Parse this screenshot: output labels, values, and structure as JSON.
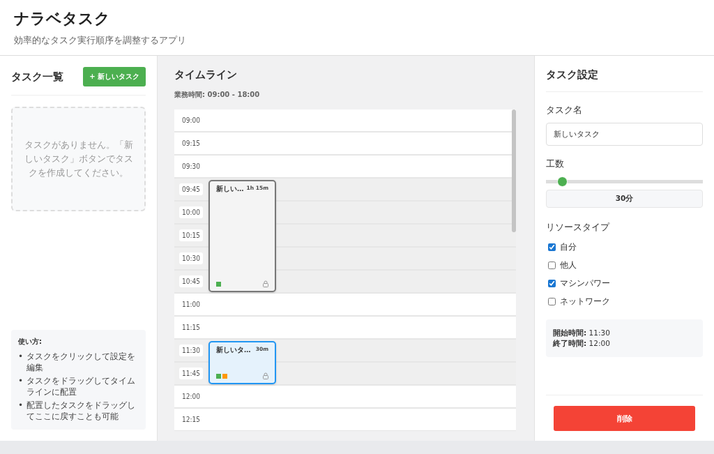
{
  "header": {
    "title": "ナラベタスク",
    "subtitle": "効率的なタスク実行順序を調整するアプリ"
  },
  "task_list": {
    "title": "タスク一覧",
    "new_button": "+ 新しいタスク",
    "empty_message": "タスクがありません。「新しいタスク」ボタンでタスクを作成してください。",
    "help": {
      "title": "使い方:",
      "items": [
        {
          "bullet": "•",
          "text": "タスクをクリックして設定を編集"
        },
        {
          "bullet": "•",
          "text": "タスクをドラッグしてタイムラインに配置"
        },
        {
          "bullet": "•",
          "text": "配置したタスクをドラッグしてここに戻すことも可能"
        }
      ]
    }
  },
  "timeline": {
    "title": "タイムライン",
    "hours": "業務時間: 09:00 - 18:00",
    "slots": [
      {
        "time": "09:00",
        "occupied": false
      },
      {
        "time": "09:15",
        "occupied": false
      },
      {
        "time": "09:30",
        "occupied": false
      },
      {
        "time": "09:45",
        "occupied": true,
        "task": {
          "title": "新しい…",
          "duration": "1h 15m",
          "selected": false,
          "resources": [
            {
              "color": "#4caf50"
            }
          ]
        }
      },
      {
        "time": "10:00",
        "occupied": true
      },
      {
        "time": "10:15",
        "occupied": true
      },
      {
        "time": "10:30",
        "occupied": true
      },
      {
        "time": "10:45",
        "occupied": true
      },
      {
        "time": "11:00",
        "occupied": false
      },
      {
        "time": "11:15",
        "occupied": false
      },
      {
        "time": "11:30",
        "occupied": true,
        "task": {
          "title": "新しいタ…",
          "duration": "30m",
          "selected": true,
          "resources": [
            {
              "color": "#4caf50"
            },
            {
              "color": "#ff9800"
            }
          ]
        }
      },
      {
        "time": "11:45",
        "occupied": true
      },
      {
        "time": "12:00",
        "occupied": false
      },
      {
        "time": "12:15",
        "occupied": false
      }
    ]
  },
  "settings": {
    "title": "タスク設定",
    "name_label": "タスク名",
    "name_value": "新しいタスク",
    "effort_label": "工数",
    "effort": {
      "level": 0.1,
      "reading": "30分"
    },
    "resource_label": "リソースタイプ",
    "resources": [
      {
        "label": "自分",
        "checked": true
      },
      {
        "label": "他人",
        "checked": false
      },
      {
        "label": "マシンパワー",
        "checked": true
      },
      {
        "label": "ネットワーク",
        "checked": false
      }
    ],
    "start_label": "開始時間:",
    "start_value": "11:30",
    "end_label": "終了時間:",
    "end_value": "12:00",
    "delete_button": "削除"
  }
}
